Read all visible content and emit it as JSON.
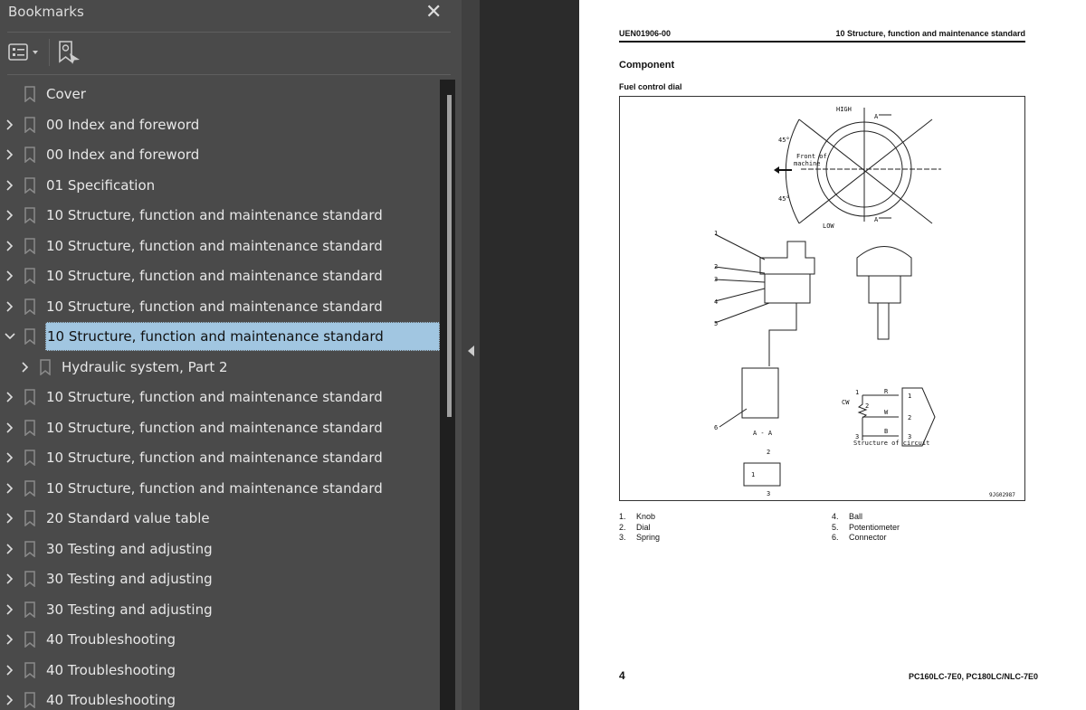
{
  "sidebar": {
    "title": "Bookmarks",
    "close_icon": "close-icon",
    "toolbar": {
      "options_icon": "list-options-icon",
      "find_icon": "find-bookmark-icon"
    },
    "items": [
      {
        "label": "Cover",
        "expander": "none",
        "level": 0
      },
      {
        "label": "00 Index and foreword",
        "expander": "collapsed",
        "level": 0
      },
      {
        "label": "00 Index and foreword",
        "expander": "collapsed",
        "level": 0
      },
      {
        "label": "01 Specification",
        "expander": "collapsed",
        "level": 0
      },
      {
        "label": "10 Structure, function and maintenance standard",
        "expander": "collapsed",
        "level": 0
      },
      {
        "label": "10 Structure, function and maintenance standard",
        "expander": "collapsed",
        "level": 0
      },
      {
        "label": "10 Structure, function and maintenance standard",
        "expander": "collapsed",
        "level": 0
      },
      {
        "label": "10 Structure, function and maintenance standard",
        "expander": "collapsed",
        "level": 0
      },
      {
        "label": "10 Structure, function and maintenance standard",
        "expander": "expanded",
        "level": 0,
        "selected": true
      },
      {
        "label": "Hydraulic system, Part 2",
        "expander": "collapsed",
        "level": 1
      },
      {
        "label": "10 Structure, function and maintenance standard",
        "expander": "collapsed",
        "level": 0
      },
      {
        "label": "10 Structure, function and maintenance standard",
        "expander": "collapsed",
        "level": 0
      },
      {
        "label": "10 Structure, function and maintenance standard",
        "expander": "collapsed",
        "level": 0
      },
      {
        "label": "10 Structure, function and maintenance standard",
        "expander": "collapsed",
        "level": 0
      },
      {
        "label": "20 Standard value table",
        "expander": "collapsed",
        "level": 0
      },
      {
        "label": "30 Testing and adjusting",
        "expander": "collapsed",
        "level": 0
      },
      {
        "label": "30 Testing and adjusting",
        "expander": "collapsed",
        "level": 0
      },
      {
        "label": "30 Testing and adjusting",
        "expander": "collapsed",
        "level": 0
      },
      {
        "label": "40 Troubleshooting",
        "expander": "collapsed",
        "level": 0
      },
      {
        "label": "40 Troubleshooting",
        "expander": "collapsed",
        "level": 0
      },
      {
        "label": "40 Troubleshooting",
        "expander": "collapsed",
        "level": 0
      }
    ],
    "selected_color": "#a1c6e1"
  },
  "page": {
    "doc_id": "UEN01906-00",
    "section": "10 Structure, function and maintenance standard",
    "heading": "Component",
    "subheading": "Fuel control dial",
    "figure": {
      "high": "HIGH",
      "low": "LOW",
      "deg_top": "45°",
      "deg_bottom": "45°",
      "front1": "Front of",
      "front2": "machine",
      "sec_a": "A",
      "section_view": "A - A",
      "circuit_caption": "Structure of circuit",
      "cw": "CW",
      "wires": [
        "R",
        "W",
        "B"
      ],
      "pins": [
        "1",
        "2",
        "3"
      ],
      "callouts": [
        "1",
        "2",
        "3",
        "4",
        "5",
        "6"
      ],
      "connector_pins": [
        "2",
        "1",
        "3"
      ],
      "fig_id": "9JG02987"
    },
    "legend": [
      "1.",
      "Knob",
      "2.",
      "Dial",
      "3.",
      "Spring",
      "4.",
      "Ball",
      "5.",
      "Potentiometer",
      "6.",
      "Connector"
    ],
    "page_number": "4",
    "models": "PC160LC-7E0, PC180LC/NLC-7E0"
  }
}
